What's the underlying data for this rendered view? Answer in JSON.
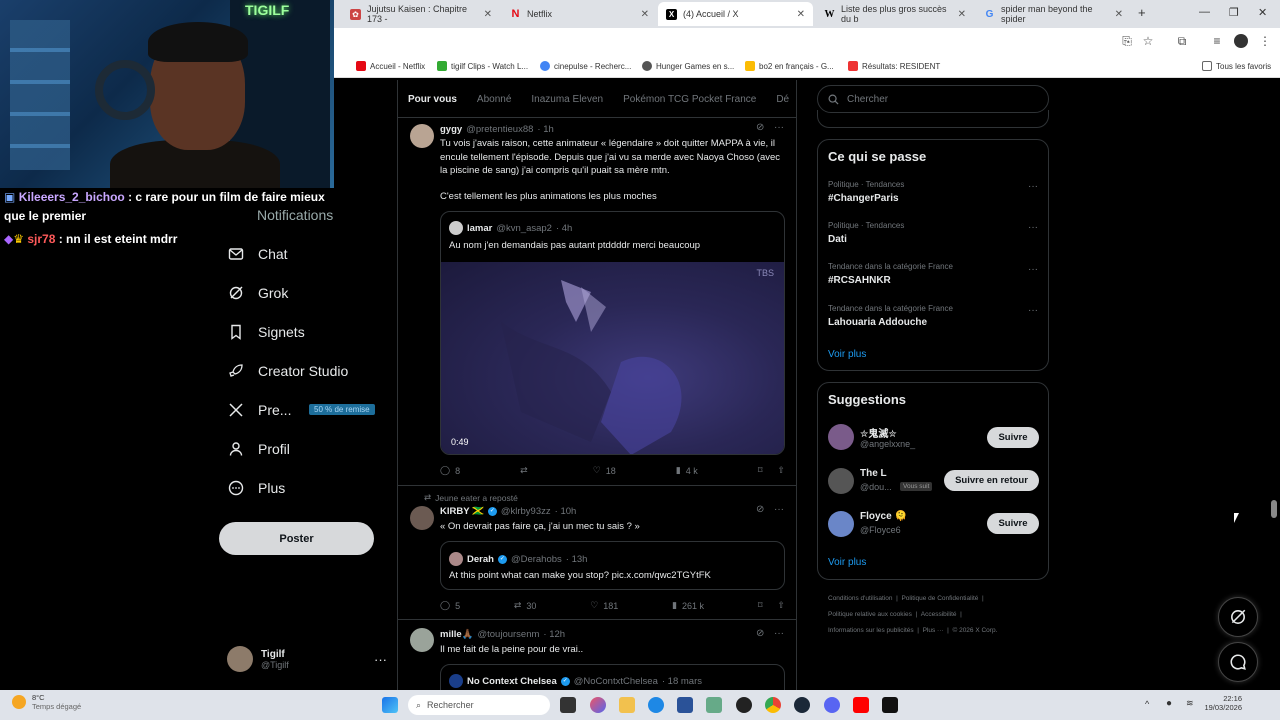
{
  "browser": {
    "tabs": [
      {
        "title": "Jujutsu Kaisen : Chapitre 173 -",
        "active": false
      },
      {
        "title": "Netflix",
        "active": false
      },
      {
        "title": "(4) Accueil / X",
        "active": true
      },
      {
        "title": "Liste des plus gros succès du b",
        "active": false
      },
      {
        "title": "spider man beyond the spider",
        "active": false
      }
    ],
    "new_tab": "+",
    "bookmarks": [
      "Accueil - Netflix",
      "tigilf Clips - Watch L...",
      "cinepulse - Recherc...",
      "Hunger Games en s...",
      "bo2 en français - G...",
      "Résultats: RESIDENT"
    ],
    "all_bookmarks": "Tous les favoris"
  },
  "stream": {
    "neon_sign": "TIGILF",
    "chat": [
      {
        "user": "Kileeers_2_bichoo",
        "message": ": c rare pour un film de faire mieux que le premier"
      },
      {
        "user": "sjr78",
        "message": ": nn il est eteint mdrr"
      }
    ]
  },
  "nav": {
    "items": [
      "Notifications",
      "Chat",
      "Grok",
      "Signets",
      "Creator Studio",
      "Pre...",
      "Profil",
      "Plus"
    ],
    "promo": "50 % de remise",
    "post_button": "Poster",
    "account": {
      "name": "Tigilf",
      "handle": "@Tigilf"
    }
  },
  "feed": {
    "tabs": [
      "Pour vous",
      "Abonné",
      "Inazuma Eleven",
      "Pokémon TCG Pocket France",
      "Dé"
    ],
    "posts": [
      {
        "name": "gygy",
        "handle": "@pretentieux88",
        "time": "· 1h",
        "text1": "Tu vois j'avais raison, cette animateur « légendaire » doit quitter MAPPA à vie, il encule tellement l'épisode. Depuis que j'ai vu sa merde avec Naoya Choso (avec la piscine de sang) j'ai compris qu'il puait sa mère mtn.",
        "text2": "C'est tellement les plus animations les plus moches",
        "quote": {
          "name": "lamar",
          "handle": "@kvn_asap2",
          "time": "· 4h",
          "text": "Au nom j'en demandais pas autant ptddddr merci beaucoup",
          "duration": "0:49",
          "watermark": "TBS"
        },
        "replies": "8",
        "reposts": "",
        "likes": "18",
        "views": "4 k"
      },
      {
        "repost_by": "Jeune eater a reposté",
        "name": "KIRBY 🇯🇲",
        "handle": "@klrby93zz",
        "time": "· 10h",
        "text1": "« On devrait pas faire ça, j'ai un mec tu sais ? »",
        "quote": {
          "name": "Derah",
          "handle": "@Derahobs",
          "time": "· 13h",
          "text": "At this point what can make you stop? pic.x.com/qwc2TGYtFK"
        },
        "replies": "5",
        "reposts": "30",
        "likes": "181",
        "views": "261 k"
      },
      {
        "name": "mille🙏🏾",
        "handle": "@toujoursenm",
        "time": "· 12h",
        "text1": "Il me fait de la peine pour de vrai..",
        "quote": {
          "name": "No Context Chelsea",
          "handle": "@NoContxtChelsea",
          "time": "· 18 mars"
        }
      }
    ]
  },
  "sidebar": {
    "search_placeholder": "Chercher",
    "trends_title": "Ce qui se passe",
    "trends": [
      {
        "context": "Politique · Tendances",
        "name": "#ChangerParis"
      },
      {
        "context": "Politique · Tendances",
        "name": "Dati"
      },
      {
        "context": "Tendance dans la catégorie France",
        "name": "#RCSAHNKR"
      },
      {
        "context": "Tendance dans la catégorie France",
        "name": "Lahouaria Addouche"
      }
    ],
    "see_more": "Voir plus",
    "suggestions_title": "Suggestions",
    "suggestions": [
      {
        "name": "✮鬼滅✮",
        "handle": "@angelxxne_",
        "button": "Suivre"
      },
      {
        "name": "The L",
        "handle": "@dou...",
        "badge": "Vous suit",
        "button": "Suivre en retour"
      },
      {
        "name": "Floyce 🫠",
        "handle": "@Floyce6",
        "button": "Suivre"
      }
    ],
    "footer_line1": [
      "Conditions d'utilisation",
      "|",
      "Politique de Confidentialité",
      "|"
    ],
    "footer_line2": [
      "Politique relative aux cookies",
      "|",
      "Accessibilité",
      "|"
    ],
    "footer_line3": [
      "Informations sur les publicités",
      "|",
      "Plus ···",
      "|",
      "© 2026 X Corp."
    ]
  },
  "taskbar": {
    "weather_temp": "8°C",
    "weather_desc": "Temps dégagé",
    "search": "Rechercher",
    "time": "22:16",
    "date": "19/03/2026"
  },
  "colors": {
    "accent": "#1d9bf0",
    "background": "#000000",
    "border": "#2f3336",
    "muted": "#71767b"
  }
}
